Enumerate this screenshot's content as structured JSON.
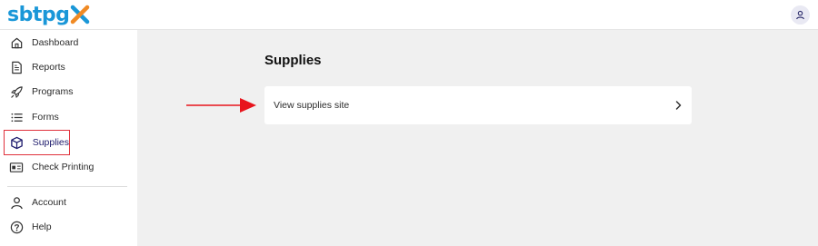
{
  "app": {
    "logo_text": "sbtpg"
  },
  "sidebar": {
    "items": [
      {
        "label": "Dashboard",
        "icon": "home-icon"
      },
      {
        "label": "Reports",
        "icon": "document-icon"
      },
      {
        "label": "Programs",
        "icon": "rocket-icon"
      },
      {
        "label": "Forms",
        "icon": "list-icon"
      },
      {
        "label": "Supplies",
        "icon": "box-icon",
        "active": true
      },
      {
        "label": "Check Printing",
        "icon": "check-printer-icon"
      }
    ],
    "secondary_items": [
      {
        "label": "Account",
        "icon": "user-icon"
      },
      {
        "label": "Help",
        "icon": "help-icon"
      }
    ]
  },
  "main": {
    "title": "Supplies",
    "card": {
      "label": "View supplies site",
      "icon": "chevron-right-icon"
    }
  },
  "colors": {
    "brand_blue": "#1a97d8",
    "brand_orange": "#f08a24",
    "active_text": "#1d1a6c",
    "active_border": "#e0313c",
    "annotation_arrow": "#e8141c",
    "main_bg": "#f0f0f0"
  }
}
